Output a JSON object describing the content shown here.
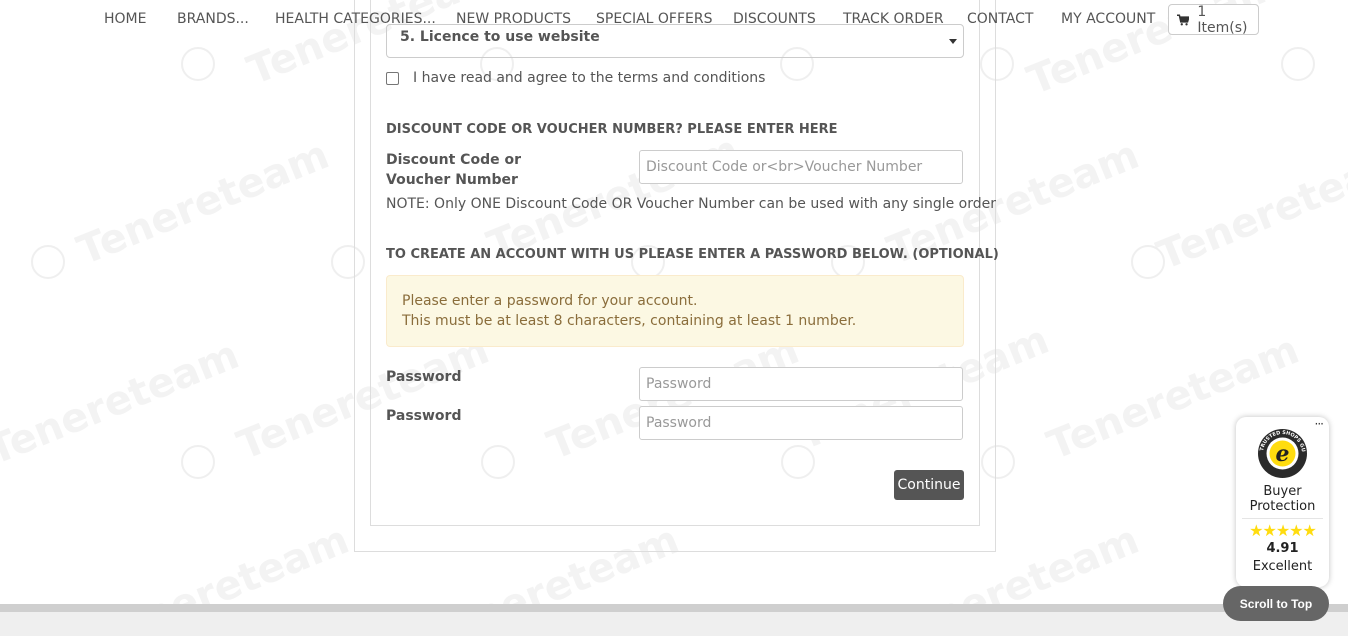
{
  "nav": {
    "items": [
      "HOME",
      "BRANDS...",
      "HEALTH CATEGORIES...",
      "NEW PRODUCTS",
      "SPECIAL OFFERS",
      "DISCOUNTS",
      "TRACK ORDER",
      "CONTACT",
      "MY ACCOUNT"
    ],
    "cart_label": "1 Item(s)"
  },
  "checkout": {
    "licence_select_value": "5. Licence to use website",
    "terms_label": "I have read and agree to the terms and conditions",
    "discount_heading": "DISCOUNT CODE OR VOUCHER NUMBER? PLEASE ENTER HERE",
    "discount_label_line1": "Discount Code or",
    "discount_label_line2": "Voucher Number",
    "discount_placeholder": "Discount Code or<br>Voucher Number",
    "discount_note": "NOTE: Only ONE Discount Code OR Voucher Number can be used with any single order",
    "account_heading": "TO CREATE AN ACCOUNT WITH US PLEASE ENTER A PASSWORD BELOW. (OPTIONAL)",
    "alert_line1": "Please enter a password for your account.",
    "alert_line2": "This must be at least 8 characters, containing at least 1 number.",
    "password_label": "Password",
    "password_confirm_label": "Password",
    "password_placeholder": "Password",
    "password_confirm_placeholder": "Password",
    "continue_label": "Continue"
  },
  "watermark": {
    "text": "Tenereteam"
  },
  "trust_badge": {
    "menu": "···",
    "protection_line1": "Buyer",
    "protection_line2": "Protection",
    "stars": "★★★★★",
    "score": "4.91",
    "grade": "Excellent",
    "seal_text": "TRUSTED SHOPS GUARANTEE",
    "seal_letter": "e"
  },
  "scroll_top_label": "Scroll to Top",
  "colors": {
    "alert_bg": "#fcf8e3",
    "alert_text": "#8a6d3b",
    "button_bg": "#555555",
    "star": "#ffdc0f"
  }
}
